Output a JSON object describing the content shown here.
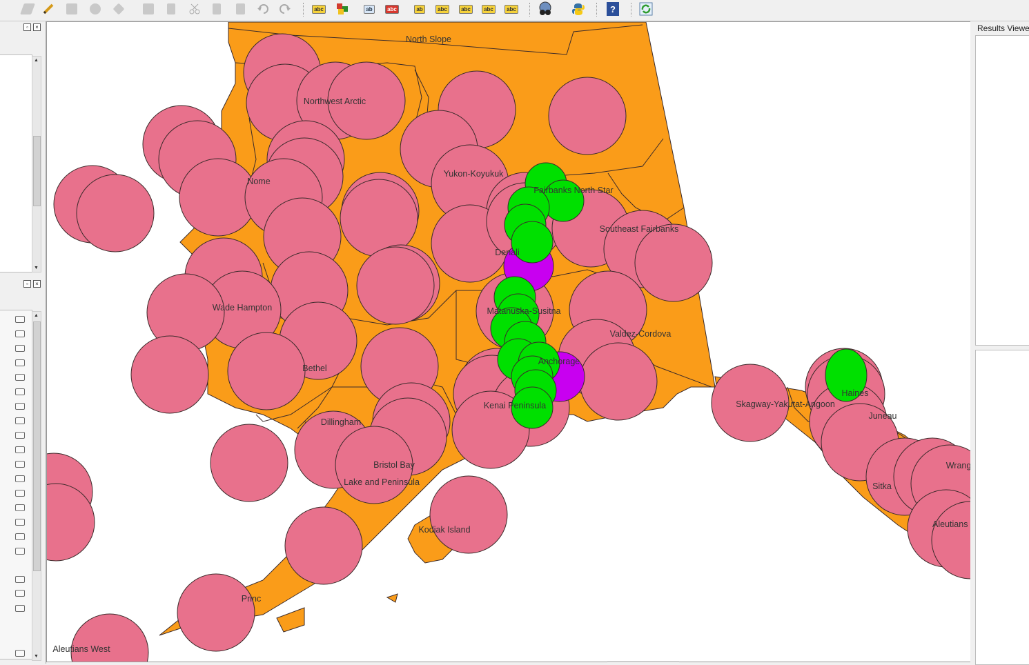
{
  "toolbar": {
    "buttons": [
      "edit-pencil",
      "toggle-editing",
      "save-edits",
      "add-feature",
      "node-tool",
      "field-calculator",
      "delete-selected",
      "cut",
      "copy",
      "paste",
      "undo",
      "redo"
    ],
    "label_icon_text": "abc",
    "label_icon_text_short": "ab"
  },
  "results_viewer": {
    "title": "Results Viewer"
  },
  "colors": {
    "land": "#fa9c19",
    "buffer_pink": "#e8718c",
    "buffer_green": "#00e000",
    "buffer_purple": "#c800f0",
    "outline": "#3a2a2a"
  },
  "map": {
    "region_labels": [
      "North Slope",
      "Northwest Arctic",
      "Nome",
      "Yukon-Koyukuk",
      "Fairbanks North Star",
      "Southeast Fairbanks",
      "Denali",
      "Wade Hampton",
      "Matanuska-Susitna",
      "Valdez-Cordova",
      "Bethel",
      "Anchorage",
      "Kenai Peninsula",
      "Dillingham",
      "Skagway-Yakutat-Angoon",
      "Haines",
      "Juneau",
      "Bristol Bay",
      "Lake and Peninsula",
      "Wrang",
      "Sitka",
      "Kodiak Island",
      "Princ",
      "Aleutians East",
      "Aleutians West"
    ]
  }
}
